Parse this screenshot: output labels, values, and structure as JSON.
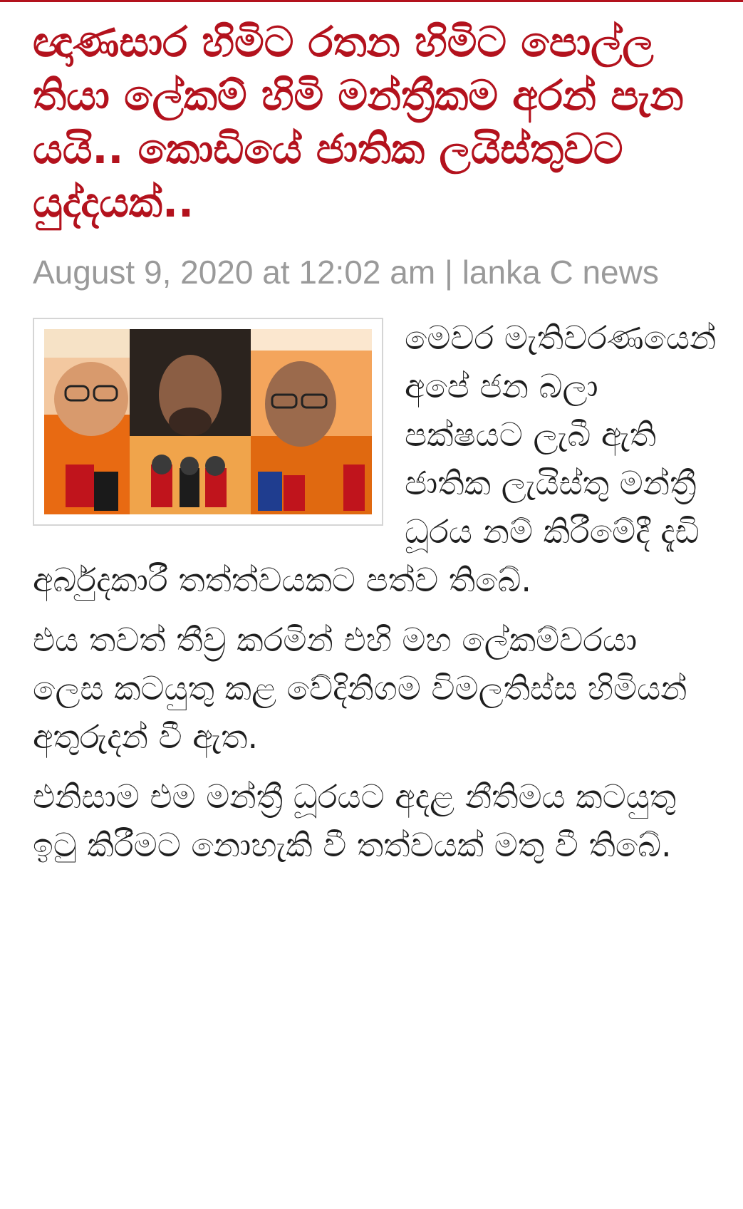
{
  "article": {
    "headline": "ඥාණසාර හිමිට රතන හිමිට පොල්ල තියා ලේකම් හිමි මන්ත්‍රීකම අරන් පැන යයි.. කොඩියේ ජාතික ලයිස්තුවට යුද්දයක්..",
    "meta": "August 9, 2020 at 12:02 am | lanka C news",
    "paragraphs": [
      "මෙවර මැතිවරණයෙන් අපේ ජන බලා පක්ෂයට ලැබී ඇති ජාතික ලැයිස්තු මන්ත්‍රී ධූරය නම් කිරීමේදී දැඩි අර්බුදකාරී තත්ත්වයකට පත්ව තිබේ.",
      "එය තවත් තීව්‍ර කරමින් එහි මහ ලේකම්වරයා ලෙස කටයුතු කළ වේදිනිගම විමලතිස්ස හිමියන් අතුරුදන් වී ඇත.",
      "එනිසාම එම මන්ත්‍රී ධූරයට අදළ නීතිමය කටයුතු ඉටු කිරීමට නොහැකි වී තත්වයක් මතු වී තිබේ."
    ]
  },
  "colors": {
    "headline": "#b3121d",
    "meta": "#9a9a9a",
    "body_text": "#1f1f1f"
  }
}
